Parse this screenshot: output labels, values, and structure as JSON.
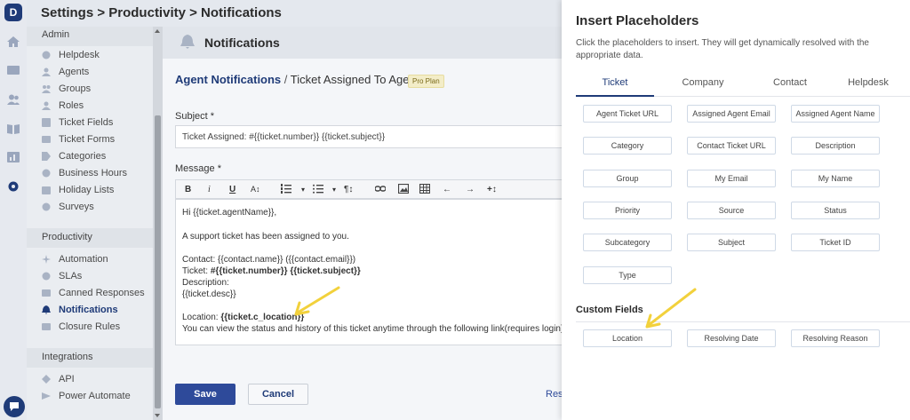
{
  "header": {
    "breadcrumb": "Settings > Productivity > Notifications"
  },
  "sidebar": {
    "admin_title": "Admin",
    "admin_items": [
      {
        "label": "Helpdesk",
        "icon": "globe-icon"
      },
      {
        "label": "Agents",
        "icon": "person-icon"
      },
      {
        "label": "Groups",
        "icon": "group-icon"
      },
      {
        "label": "Roles",
        "icon": "person-icon"
      },
      {
        "label": "Ticket Fields",
        "icon": "fields-icon"
      },
      {
        "label": "Ticket Forms",
        "icon": "form-icon"
      },
      {
        "label": "Categories",
        "icon": "tag-icon"
      },
      {
        "label": "Business Hours",
        "icon": "clock-icon"
      },
      {
        "label": "Holiday Lists",
        "icon": "calendar-icon"
      },
      {
        "label": "Surveys",
        "icon": "survey-icon"
      }
    ],
    "productivity_title": "Productivity",
    "productivity_items": [
      {
        "label": "Automation",
        "icon": "sparkle-icon",
        "active": false
      },
      {
        "label": "SLAs",
        "icon": "timer-icon",
        "active": false
      },
      {
        "label": "Canned Responses",
        "icon": "reply-icon",
        "active": false
      },
      {
        "label": "Notifications",
        "icon": "bell-icon",
        "active": true
      },
      {
        "label": "Closure Rules",
        "icon": "rules-icon",
        "active": false
      }
    ],
    "integrations_title": "Integrations",
    "integrations_items": [
      {
        "label": "API",
        "icon": "api-icon"
      },
      {
        "label": "Power Automate",
        "icon": "power-icon"
      }
    ]
  },
  "main": {
    "title": "Notifications",
    "breadcrumb_link": "Agent Notifications",
    "breadcrumb_sep": " / ",
    "breadcrumb_current": "Ticket Assigned To Agent",
    "badge": "Pro Plan",
    "subject_label": "Subject *",
    "subject_value": "Ticket Assigned: #{{ticket.number}} {{ticket.subject}}",
    "message_label": "Message *",
    "toolbar": [
      "B",
      "i",
      "U",
      "A↕",
      "list-ol",
      "▾",
      "list-ul",
      "▾",
      "¶↕",
      "link",
      "image",
      "table",
      "←",
      "→",
      "+↕"
    ],
    "message": {
      "greeting": "Hi {{ticket.agentName}},",
      "line1": "A support ticket has been assigned to you.",
      "contact": "Contact: {{contact.name}} ({{contact.email}})",
      "ticket_prefix": "Ticket: ",
      "ticket_value": "#{{ticket.number}} {{ticket.subject}}",
      "description": "Description:",
      "desc_value": "{{ticket.desc}}",
      "location_prefix": "Location: ",
      "location_value": "{{ticket.c_location}}",
      "status_line": "You can view the status and history of this ticket anytime through the following link(requires login):"
    },
    "save_label": "Save",
    "cancel_label": "Cancel",
    "reset_label": "Rese"
  },
  "panel": {
    "title": "Insert Placeholders",
    "description": "Click the placeholders to insert. They will get dynamically resolved with the appropriate data.",
    "tabs": [
      "Ticket",
      "Company",
      "Contact",
      "Helpdesk"
    ],
    "active_tab": "Ticket",
    "placeholders": [
      "Agent Ticket URL",
      "Assigned Agent Email",
      "Assigned Agent Name",
      "Category",
      "Contact Ticket URL",
      "Description",
      "Group",
      "My Email",
      "My Name",
      "Priority",
      "Source",
      "Status",
      "Subcategory",
      "Subject",
      "Ticket ID",
      "Type"
    ],
    "custom_fields_title": "Custom Fields",
    "custom_fields": [
      "Location",
      "Resolving Date",
      "Resolving Reason"
    ]
  },
  "colors": {
    "brand": "#1f3b78",
    "annotation_arrow": "#f2d13c"
  }
}
